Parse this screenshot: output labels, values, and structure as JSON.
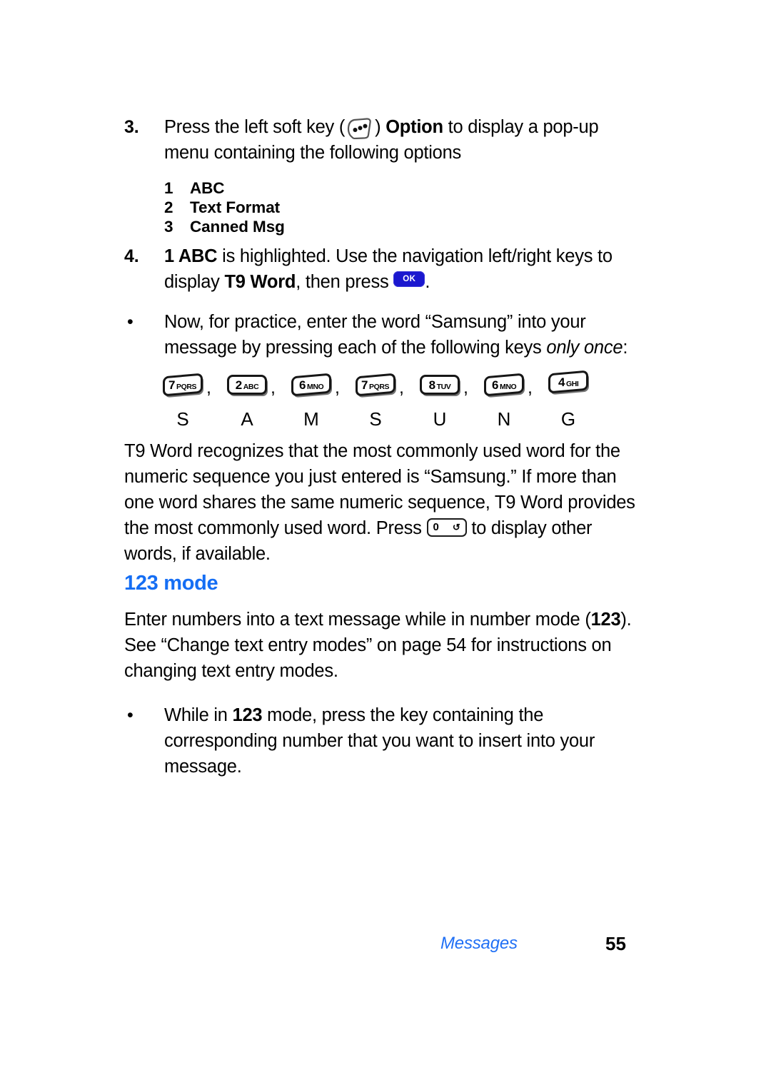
{
  "page": {
    "background": "#ffffff",
    "accent_blue": "#156ef4",
    "text_color": "#000000"
  },
  "steps": [
    {
      "number": "3.",
      "text_before_icon": "Press the left soft key (",
      "icon": "soft-key-icon",
      "text_after_icon": ") ",
      "bold_term": "Option",
      "text_tail": " to display a pop-up menu containing the following options"
    }
  ],
  "options": [
    {
      "index": "1",
      "label": "ABC"
    },
    {
      "index": "2",
      "label": "Text Format"
    },
    {
      "index": "3",
      "label": "Canned Msg"
    }
  ],
  "step4": {
    "number": "4.",
    "bold_lead": "1 ABC",
    "text_mid": " is highlighted. Use the navigation left/right keys to display ",
    "bold_term": "T9 Word",
    "text_tail": ", then press ",
    "ok_key_label": "OK",
    "period": "."
  },
  "practice_bullet": {
    "marker": "•",
    "text": "Now, for practice, enter the word “Samsung” into your message by pressing each of the following keys ",
    "italic_tail": "only once",
    "colon": ":"
  },
  "keypad": {
    "keys": [
      {
        "digit": "7",
        "letters": "PQRS",
        "skew": true
      },
      {
        "digit": "2",
        "letters": "ABC",
        "skew": false
      },
      {
        "digit": "6",
        "letters": "MNO",
        "skew": true
      },
      {
        "digit": "7",
        "letters": "PQRS",
        "skew": true
      },
      {
        "digit": "8",
        "letters": "TUV",
        "skew": false
      },
      {
        "digit": "6",
        "letters": "MNO",
        "skew": true
      },
      {
        "digit": "4",
        "letters": "GHI",
        "skew": true
      }
    ],
    "separator": ",",
    "letters": [
      "S",
      "A",
      "M",
      "S",
      "U",
      "N",
      "G"
    ]
  },
  "t9_paragraph": {
    "part1": "T9 Word recognizes that the most commonly used word for the numeric sequence you just entered is “Samsung.” If more than one word shares the same numeric sequence, T9 Word provides the most commonly used word. Press ",
    "zero_key_digit": "0",
    "zero_key_symbol": "↺",
    "part2": " to display other words, if available."
  },
  "mode123": {
    "heading": "123 mode",
    "paragraph_part1": "Enter numbers into a text message while in number mode (",
    "paragraph_bold": "123",
    "paragraph_part2": "). See “Change text entry modes” on page 54 for instructions on changing text entry modes.",
    "bullet": {
      "marker": "•",
      "text_part1": "While in ",
      "bold": "123",
      "text_part2": " mode, press the key containing the corresponding number that you want to insert into your message."
    }
  },
  "footer": {
    "section_label": "Messages",
    "page_number": "55"
  }
}
